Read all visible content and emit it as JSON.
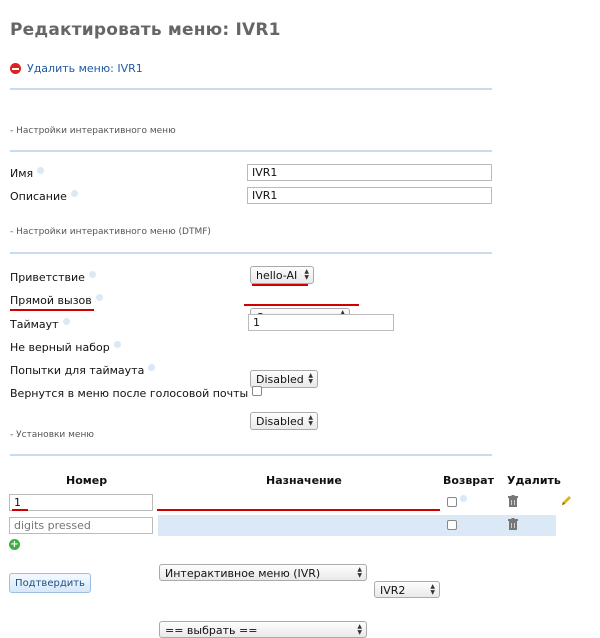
{
  "page": {
    "title": "Редактировать меню: IVR1",
    "delete_link": "Удалить меню: IVR1"
  },
  "sections": {
    "ivr_settings": "- Настройки интерактивного меню",
    "dtmf_settings": "- Настройки интерактивного меню (DTMF)",
    "menu_options": "- Установки меню"
  },
  "fields": {
    "name": {
      "label": "Имя",
      "value": "IVR1"
    },
    "description": {
      "label": "Описание",
      "value": "IVR1"
    },
    "greeting": {
      "label": "Приветствие",
      "value": "hello-AI"
    },
    "direct_dial": {
      "label": "Прямой вызов",
      "value": "Отключено"
    },
    "timeout": {
      "label": "Таймаут",
      "value": "1"
    },
    "invalid_input": {
      "label": "Не верный набор",
      "value": "Disabled"
    },
    "timeout_retries": {
      "label": "Попытки для таймаута",
      "value": "Disabled"
    },
    "return_after_voicemail": {
      "label": "Вернутся в меню после голосовой почты"
    }
  },
  "table": {
    "headers": {
      "number": "Номер",
      "destination": "Назначение",
      "return": "Возврат",
      "delete": "Удалить"
    },
    "rows": [
      {
        "number": "1",
        "destination_type": "Интерактивное меню (IVR)",
        "destination_value": "IVR2"
      },
      {
        "number_placeholder": "digits pressed",
        "destination_type": "== выбрать =="
      }
    ]
  },
  "buttons": {
    "submit": "Подтвердить"
  },
  "colors": {
    "accent": "#1f5aa6",
    "divider": "#c9dcef",
    "highlight_row": "#dbe9f6",
    "annotation": "#d10000"
  }
}
